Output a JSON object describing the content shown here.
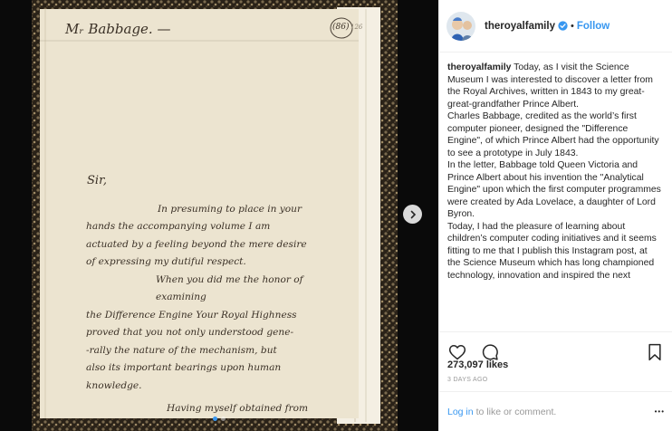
{
  "photo": {
    "heading": "Mᵣ Babbage. —",
    "page_number": "(86)",
    "page_number_small": "126",
    "letter_lines": [
      "Sir,",
      "In presuming to place in your",
      "hands the accompanying volume I am",
      "actuated by a feeling beyond the mere desire",
      "of expressing my dutiful respect.",
      "When you did me the honor of examining",
      "the Difference Engine Your Royal Highness",
      "proved that you not only understood gene-",
      "-rally the nature of the mechanism, but",
      "also its important bearings upon human",
      "knowledge.",
      "Having myself obtained from"
    ],
    "next_icon": "chevron-right-icon",
    "carousel_dots": 2,
    "carousel_active": 1
  },
  "header": {
    "username": "theroyalfamily",
    "verified_icon": "verified-badge-icon",
    "separator": "•",
    "follow_label": "Follow"
  },
  "caption": {
    "author": "theroyalfamily",
    "paragraphs": [
      "Today, as I visit the Science Museum I was interested to discover a letter from the Royal Archives, written in 1843 to my great-great-grandfather Prince Albert.",
      "Charles Babbage, credited as the world’s first computer pioneer, designed the \"Difference Engine\", of which Prince Albert had the opportunity to see a prototype in July 1843.",
      "In the letter, Babbage told Queen Victoria and Prince Albert about his invention the \"Analytical Engine\" upon which the first computer programmes were created by Ada Lovelace, a daughter of Lord Byron.",
      "Today, I had the pleasure of learning about children’s computer coding initiatives and it seems fitting to me that I publish this Instagram post, at the Science Museum which has long championed technology, innovation and inspired the next"
    ]
  },
  "actions": {
    "like_icon": "heart-icon",
    "comment_icon": "comment-icon",
    "save_icon": "bookmark-icon"
  },
  "likes": "273,097 likes",
  "timestamp": "3 days ago",
  "comment_box": {
    "login_label": "Log in",
    "prompt": "to like or comment.",
    "more_label": "•••"
  },
  "colors": {
    "link": "#3897f0",
    "text": "#262626",
    "muted": "#999999",
    "border": "#efefef",
    "paper": "#ece4d0",
    "ink": "#3a3026"
  }
}
